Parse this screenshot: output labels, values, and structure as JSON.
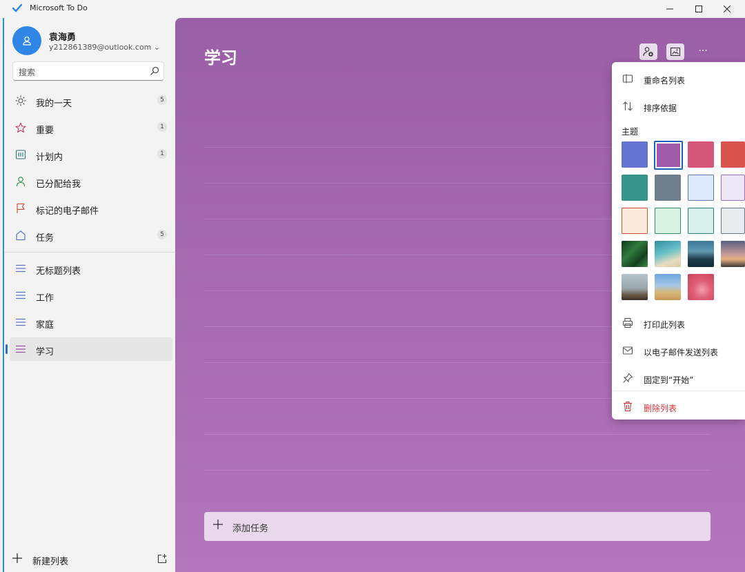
{
  "window": {
    "title": "Microsoft To Do"
  },
  "user": {
    "name": "袁海勇",
    "email": "y212861389@outlook.com ⌄"
  },
  "search": {
    "placeholder": "搜索"
  },
  "sidebar": {
    "smart_lists": [
      {
        "label": "我的一天",
        "count": "5",
        "icon": "sun-icon"
      },
      {
        "label": "重要",
        "count": "1",
        "icon": "star-icon"
      },
      {
        "label": "计划内",
        "count": "1",
        "icon": "calendar-icon"
      },
      {
        "label": "已分配给我",
        "count": "",
        "icon": "person-icon"
      },
      {
        "label": "标记的电子邮件",
        "count": "",
        "icon": "flag-icon"
      },
      {
        "label": "任务",
        "count": "5",
        "icon": "home-icon"
      }
    ],
    "lists": [
      {
        "label": "无标题列表",
        "icon": "list-icon"
      },
      {
        "label": "工作",
        "icon": "list-icon"
      },
      {
        "label": "家庭",
        "icon": "list-icon"
      },
      {
        "label": "学习",
        "icon": "list-icon"
      }
    ],
    "new_list_label": "新建列表"
  },
  "main": {
    "list_title": "学习",
    "add_task_label": "添加任务",
    "more_label": "···"
  },
  "menu": {
    "rename": "重命名列表",
    "sort": "排序依据",
    "theme_header": "主题",
    "print": "打印此列表",
    "email": "以电子邮件发送列表",
    "pin": "固定到“开始”",
    "delete": "删除列表"
  },
  "colors": {
    "accent": "#2b6cc4",
    "theme_purple": "#9b5fa8",
    "delete_red": "#d13438"
  },
  "themes": [
    {
      "name": "blue",
      "color": "#6475d4"
    },
    {
      "name": "purple",
      "color": "#a05caa",
      "selected": true
    },
    {
      "name": "pink",
      "color": "#d6567a"
    },
    {
      "name": "red",
      "color": "#d9534f"
    },
    {
      "name": "teal",
      "color": "#35958a"
    },
    {
      "name": "gray",
      "color": "#6f7f8b"
    },
    {
      "name": "light-blue",
      "color": "#dbe9fb"
    },
    {
      "name": "light-purple",
      "color": "#efe6f7"
    },
    {
      "name": "peach",
      "color": "#fbe9dd"
    },
    {
      "name": "mint",
      "color": "#d8f2e4"
    },
    {
      "name": "light-teal",
      "color": "#d6f1ec"
    },
    {
      "name": "light-gray",
      "color": "#e8ecef"
    },
    {
      "name": "photo-leaves",
      "color": "#1e4d2b"
    },
    {
      "name": "photo-beach",
      "color": "#4aa6b2"
    },
    {
      "name": "photo-mountain",
      "color": "#2d5c74"
    },
    {
      "name": "photo-sunset",
      "color": "#8c6a7a"
    },
    {
      "name": "photo-lighthouse",
      "color": "#7c8a93"
    },
    {
      "name": "photo-field",
      "color": "#8fb3d8"
    },
    {
      "name": "photo-pink",
      "color": "#d9506b"
    }
  ]
}
